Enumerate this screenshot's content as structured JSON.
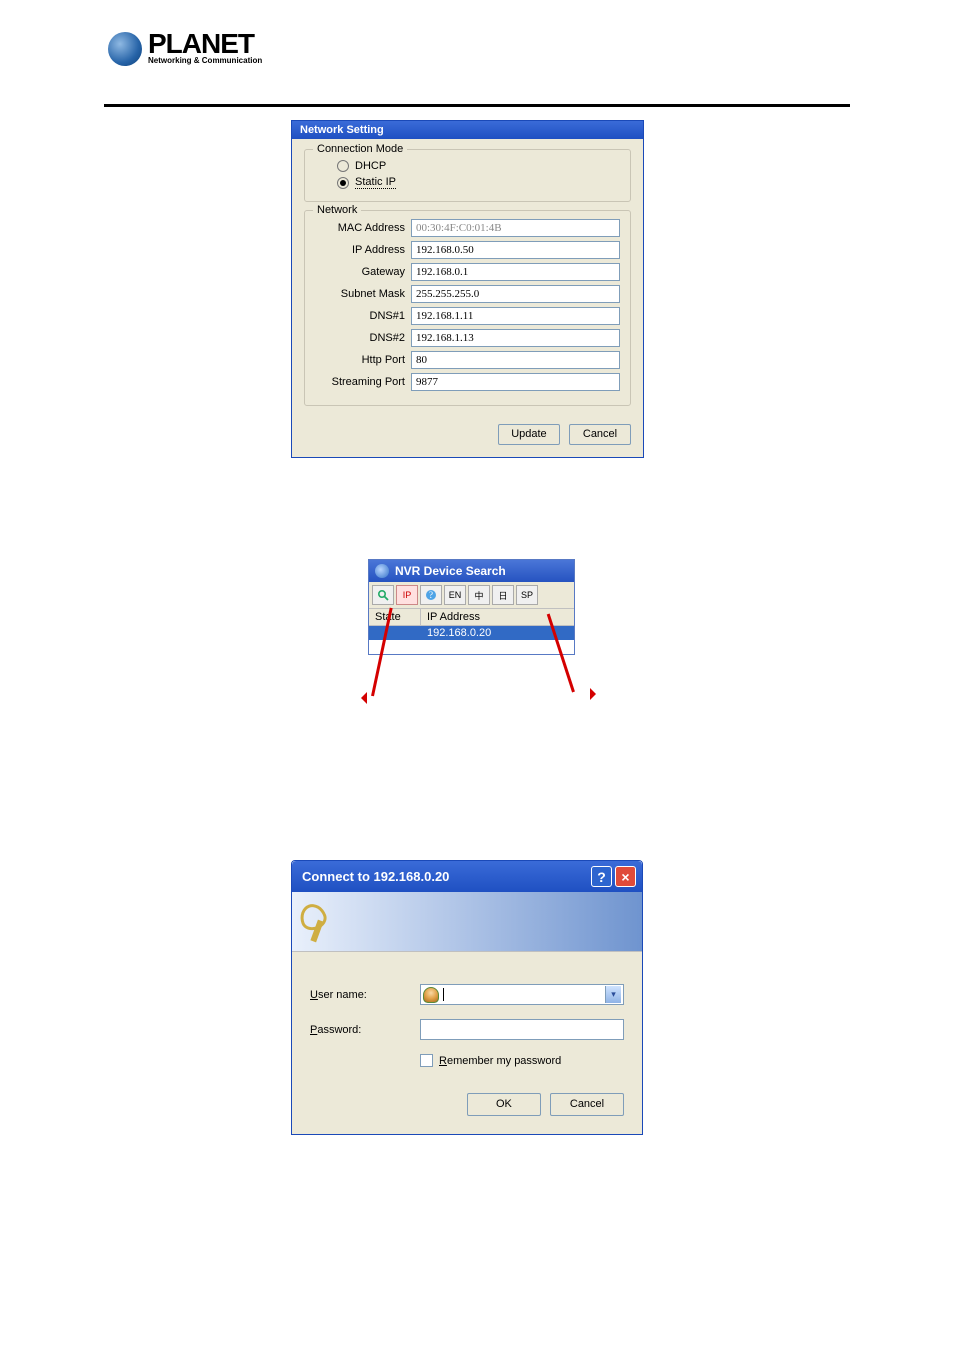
{
  "logo": {
    "name": "PLANET",
    "tagline": "Networking & Communication"
  },
  "network_setting": {
    "title": "Network Setting",
    "connection_mode": {
      "legend": "Connection Mode",
      "dhcp_label": "DHCP",
      "static_label": "Static IP"
    },
    "network": {
      "legend": "Network",
      "mac_label": "MAC Address",
      "mac_value": "00:30:4F:C0:01:4B",
      "ip_label": "IP Address",
      "ip_value": "192.168.0.50",
      "gw_label": "Gateway",
      "gw_value": "192.168.0.1",
      "sm_label": "Subnet Mask",
      "sm_value": "255.255.255.0",
      "dns1_label": "DNS#1",
      "dns1_value": "192.168.1.11",
      "dns2_label": "DNS#2",
      "dns2_value": "192.168.1.13",
      "http_label": "Http Port",
      "http_value": "80",
      "stream_label": "Streaming Port",
      "stream_value": "9877"
    },
    "update_label": "Update",
    "cancel_label": "Cancel"
  },
  "nvr": {
    "title": "NVR Device Search",
    "toolbar_ip": "IP",
    "toolbar_en": "EN",
    "toolbar_cn": "中",
    "toolbar_jp": "日",
    "toolbar_sp": "SP",
    "col_state": "State",
    "col_ip": "IP Address",
    "row1_state": "",
    "row1_ip": "192.168.0.20"
  },
  "connect": {
    "title": "Connect to 192.168.0.20",
    "user_pre": "U",
    "user_rest": "ser name:",
    "pass_pre": "P",
    "pass_rest": "assword:",
    "remember_pre": "R",
    "remember_rest": "emember my password",
    "ok_label": "OK",
    "cancel_label": "Cancel",
    "help_glyph": "?",
    "close_glyph": "×"
  }
}
